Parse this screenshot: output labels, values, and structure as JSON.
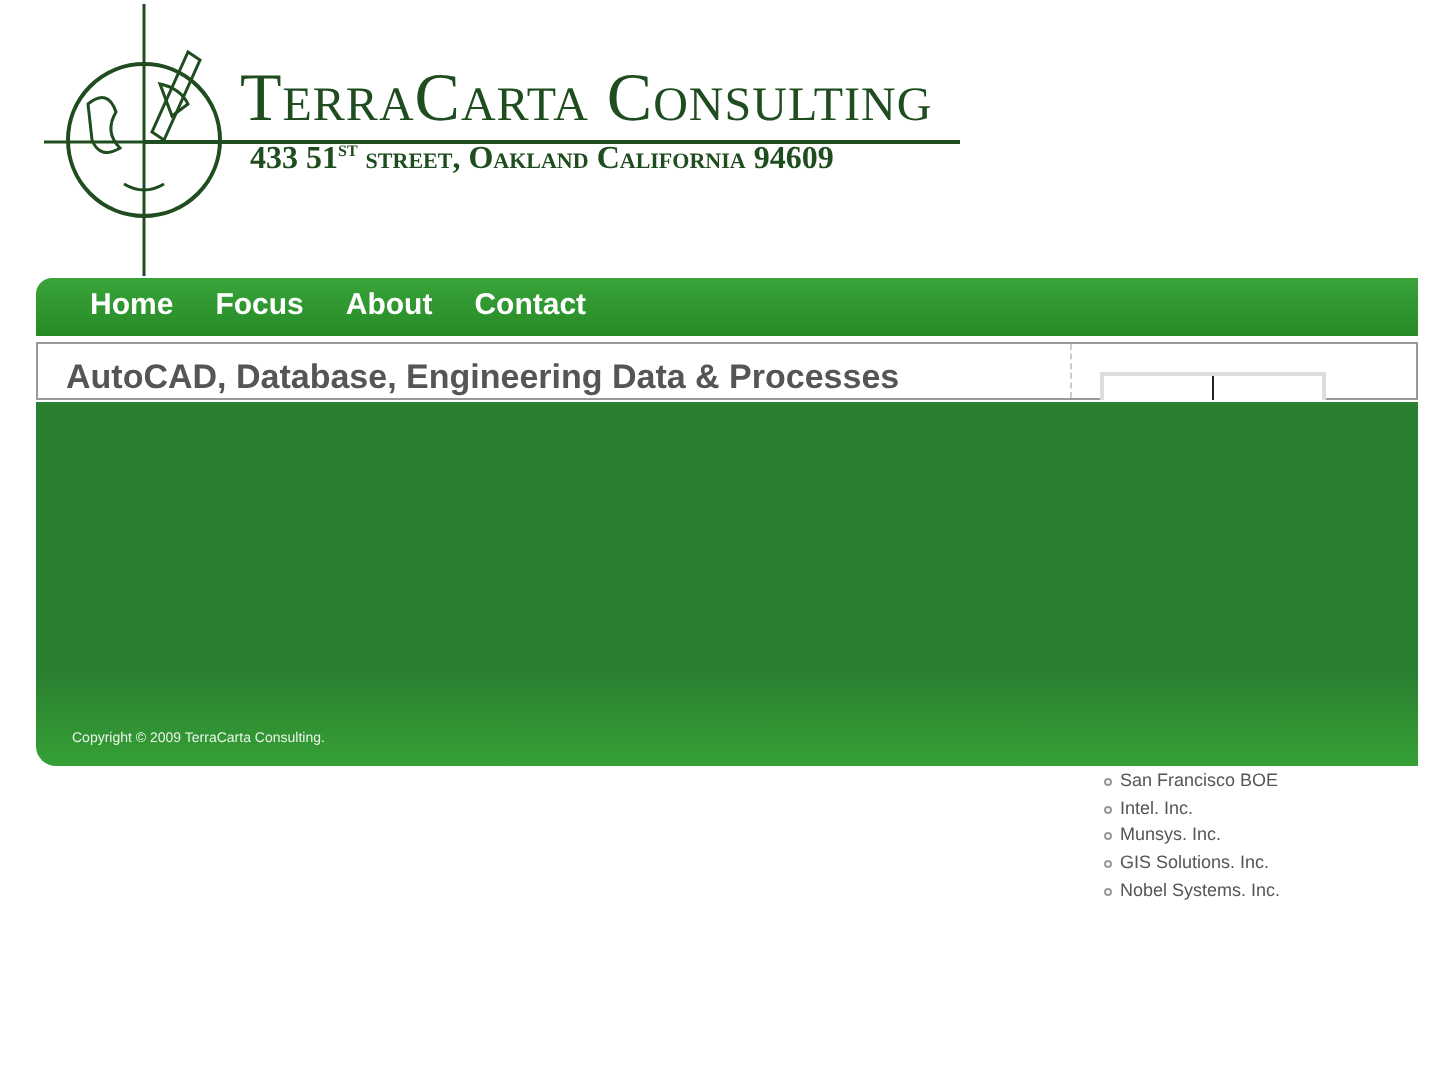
{
  "header": {
    "title": "TerraCarta Consulting",
    "address": "433 51$^{st}$ street, Oakland California 94609"
  },
  "nav": [
    {
      "label": "Home"
    },
    {
      "label": "Focus"
    },
    {
      "label": "About"
    },
    {
      "label": "Contact"
    }
  ],
  "content": {
    "heading": "AutoCAD, Database, Engineering Data & Processes"
  },
  "footer": {
    "copyright": "Copyright © 2009 TerraCarta Consulting."
  },
  "clients": [
    "San Francisco BOE",
    "Intel. Inc.",
    "Munsys. Inc.",
    "GIS Solutions. Inc.",
    "Nobel Systems. Inc."
  ]
}
